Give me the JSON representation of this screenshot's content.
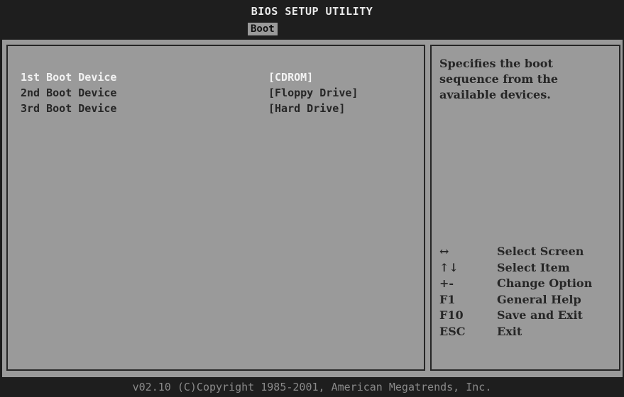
{
  "header": {
    "title": "BIOS SETUP UTILITY",
    "active_tab": "Boot"
  },
  "boot_devices": [
    {
      "label": "1st Boot Device",
      "value": "[CDROM]",
      "selected": true
    },
    {
      "label": "2nd Boot Device",
      "value": "[Floppy Drive]",
      "selected": false
    },
    {
      "label": "3rd Boot Device",
      "value": "[Hard Drive]",
      "selected": false
    }
  ],
  "help": {
    "lines": [
      "Specifies the boot",
      "sequence from the",
      "available devices."
    ]
  },
  "key_legend": [
    {
      "key": "↔",
      "desc": "Select Screen"
    },
    {
      "key": "↑↓",
      "desc": "Select Item"
    },
    {
      "key": "+-",
      "desc": "Change Option"
    },
    {
      "key": "F1",
      "desc": "General Help"
    },
    {
      "key": "F10",
      "desc": "Save and Exit"
    },
    {
      "key": "ESC",
      "desc": "Exit"
    }
  ],
  "footer": {
    "text": "v02.10 (C)Copyright 1985-2001, American Megatrends, Inc."
  }
}
